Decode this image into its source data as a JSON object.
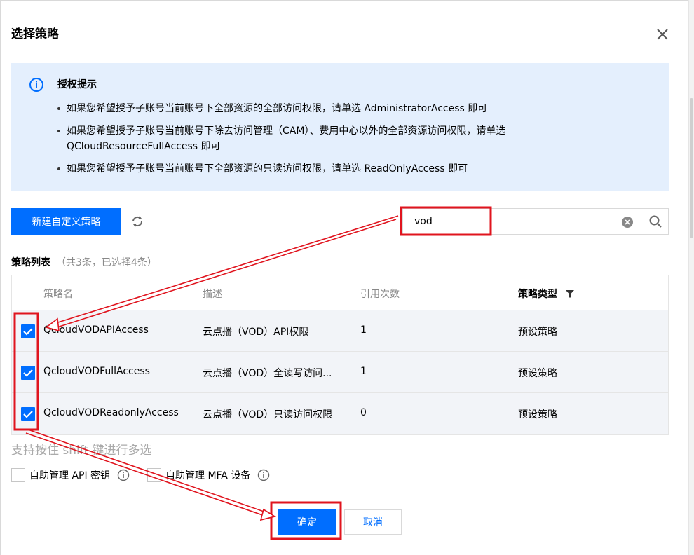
{
  "dialog": {
    "title": "选择策略"
  },
  "notice": {
    "title": "授权提示",
    "items": [
      {
        "line1": "如果您希望授予子账号当前账号下全部资源的全部访问权限，请单选 AdministratorAccess 即可",
        "line2": ""
      },
      {
        "line1": "如果您希望授予子账号当前账号下除去访问管理（CAM）、费用中心以外的全部资源访问权限，请单选",
        "line2": "QCloudResourceFullAccess 即可"
      },
      {
        "line1": "如果您希望授予子账号当前账号下全部资源的只读访问权限，请单选 ReadOnlyAccess 即可",
        "line2": ""
      }
    ]
  },
  "toolbar": {
    "new_policy_label": "新建自定义策略"
  },
  "search": {
    "value": "vod",
    "placeholder": ""
  },
  "policy_list": {
    "title": "策略列表",
    "count_text": "（共3条，已选择4条）",
    "columns": {
      "name": "策略名",
      "desc": "描述",
      "refs": "引用次数",
      "type": "策略类型"
    },
    "rows": [
      {
        "name": "QcloudVODAPIAccess",
        "desc": "云点播（VOD）API权限",
        "refs": "1",
        "type": "预设策略",
        "checked": true
      },
      {
        "name": "QcloudVODFullAccess",
        "desc": "云点播（VOD）全读写访问...",
        "refs": "1",
        "type": "预设策略",
        "checked": true
      },
      {
        "name": "QcloudVODReadonlyAccess",
        "desc": "云点播（VOD）只读访问权限",
        "refs": "0",
        "type": "预设策略",
        "checked": true
      }
    ]
  },
  "hint": "支持按住 shift 键进行多选",
  "options": {
    "api_key": "自助管理 API 密钥",
    "mfa": "自助管理 MFA 设备"
  },
  "footer": {
    "ok_label": "确定",
    "cancel_label": "取消"
  },
  "colors": {
    "primary": "#006eff",
    "notice_bg": "#e4effd",
    "row_bg": "#f2f4f8",
    "annotation_red": "#e0141e"
  }
}
